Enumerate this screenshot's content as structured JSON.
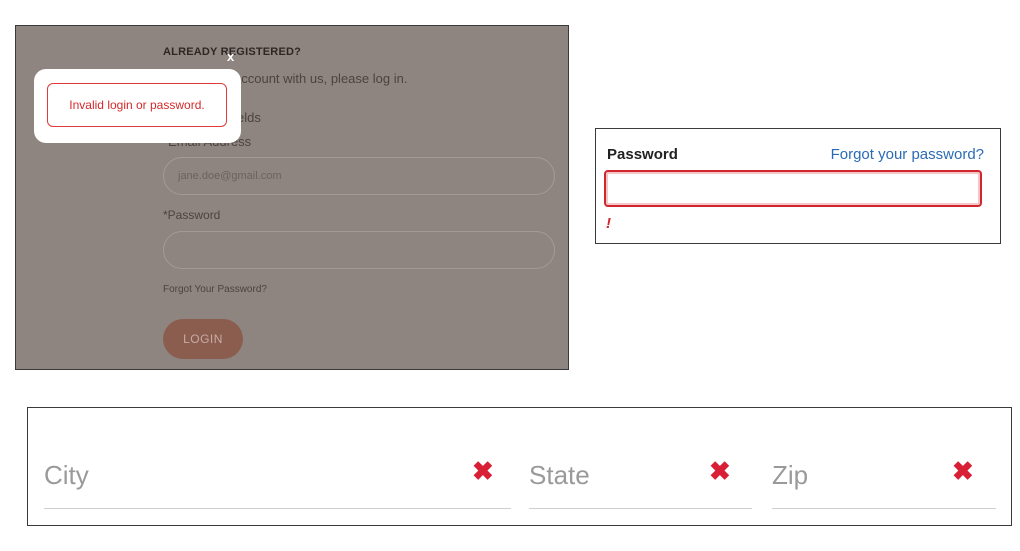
{
  "login_panel": {
    "heading": "ALREADY REGISTERED?",
    "intro": "account with us, please log in.",
    "required_note": "elds",
    "email_label": "*Email Address",
    "email_value": "jane.doe@gmail.com",
    "password_label": "*Password",
    "forgot_link": "Forgot Your Password?",
    "login_button": "LOGIN",
    "modal": {
      "error_message": "Invalid login or password.",
      "close_label": "x"
    },
    "colors": {
      "overlay": "#8f8580",
      "error": "#e23a3a",
      "button": "#8b5d4f"
    }
  },
  "password_panel": {
    "label": "Password",
    "forgot_link": "Forgot your password?",
    "error_marker": "!",
    "colors": {
      "error": "#d0262e",
      "link": "#2a6bb4"
    }
  },
  "address_panel": {
    "fields": [
      {
        "label": "City",
        "clear_icon": "close-icon"
      },
      {
        "label": "State",
        "clear_icon": "close-icon"
      },
      {
        "label": "Zip",
        "clear_icon": "close-icon"
      }
    ],
    "error_icon_glyph": "✖",
    "colors": {
      "error_icon": "#d81f35",
      "placeholder": "#9a9a9a"
    }
  }
}
